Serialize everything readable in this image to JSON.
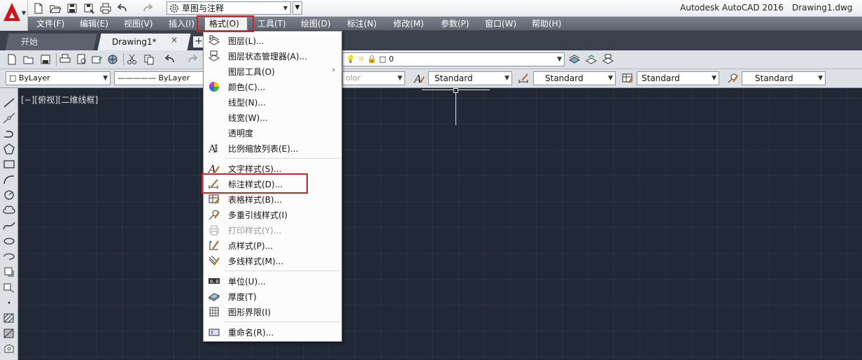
{
  "window": {
    "app_title": "Autodesk AutoCAD 2016",
    "doc_title": "Drawing1.dwg",
    "workspace": "草图与注释"
  },
  "menubar": [
    {
      "label": "文件(F)"
    },
    {
      "label": "编辑(E)"
    },
    {
      "label": "视图(V)"
    },
    {
      "label": "插入(I)"
    },
    {
      "label": "格式(O)"
    },
    {
      "label": "工具(T)"
    },
    {
      "label": "绘图(D)"
    },
    {
      "label": "标注(N)"
    },
    {
      "label": "修改(M)"
    },
    {
      "label": "参数(P)"
    },
    {
      "label": "窗口(W)"
    },
    {
      "label": "帮助(H)"
    }
  ],
  "tabs": {
    "start": "开始",
    "drawing": "Drawing1*",
    "close": "×",
    "plus": "+"
  },
  "toolbar1": {
    "layer_value": "0"
  },
  "toolbar2": {
    "color_value": "ByLayer",
    "linetype_value": "ByLayer",
    "lineweight_value": "olor",
    "text_style": "Standard",
    "dim_style": "Standard",
    "table_style": "Standard",
    "mleader_style": "Standard"
  },
  "viewport_label": "[−][俯视][二维线框]",
  "format_menu": {
    "items": [
      {
        "label": "图层(L)..."
      },
      {
        "label": "图层状态管理器(A)..."
      },
      {
        "label": "图层工具(O)",
        "submenu": "›"
      },
      {
        "label": "颜色(C)..."
      },
      {
        "label": "线型(N)..."
      },
      {
        "label": "线宽(W)..."
      },
      {
        "label": "透明度"
      },
      {
        "label": "比例缩放列表(E)..."
      },
      {
        "label": "文字样式(S)..."
      },
      {
        "label": "标注样式(D)..."
      },
      {
        "label": "表格样式(B)..."
      },
      {
        "label": "多重引线样式(I)"
      },
      {
        "label": "打印样式(Y)...",
        "disabled": true
      },
      {
        "label": "点样式(P)..."
      },
      {
        "label": "多线样式(M)..."
      },
      {
        "label": "单位(U)..."
      },
      {
        "label": "厚度(T)"
      },
      {
        "label": "图形界限(I)"
      },
      {
        "label": "重命名(R)..."
      }
    ]
  },
  "colors": {
    "highlight": "#d0202a",
    "canvas": "#212836",
    "menubar": "#666c77"
  }
}
